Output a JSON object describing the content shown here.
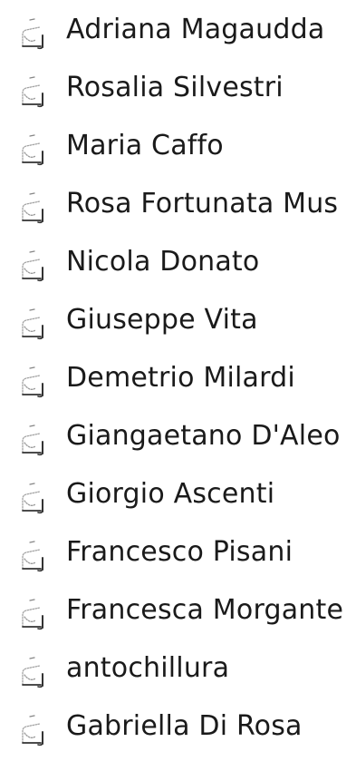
{
  "contacts": {
    "items": [
      {
        "name": "Adriana Magaudda",
        "icon": "contact-card-icon"
      },
      {
        "name": "Rosalia Silvestri",
        "icon": "contact-card-icon"
      },
      {
        "name": "Maria Caffo",
        "icon": "contact-card-icon"
      },
      {
        "name": "Rosa Fortunata Mus",
        "icon": "contact-card-icon"
      },
      {
        "name": "Nicola Donato",
        "icon": "contact-card-icon"
      },
      {
        "name": "Giuseppe Vita",
        "icon": "contact-card-icon"
      },
      {
        "name": "Demetrio Milardi",
        "icon": "contact-card-icon"
      },
      {
        "name": "Giangaetano D'Aleo",
        "icon": "contact-card-icon"
      },
      {
        "name": "Giorgio Ascenti",
        "icon": "contact-card-icon"
      },
      {
        "name": "Francesco Pisani",
        "icon": "contact-card-icon"
      },
      {
        "name": "Francesca Morgante",
        "icon": "contact-card-icon"
      },
      {
        "name": "antochillura",
        "icon": "contact-card-icon"
      },
      {
        "name": "Gabriella Di Rosa",
        "icon": "contact-card-icon"
      }
    ]
  },
  "colors": {
    "text": "#1a1a1a",
    "background": "#ffffff",
    "icon_stroke": "#333333"
  }
}
